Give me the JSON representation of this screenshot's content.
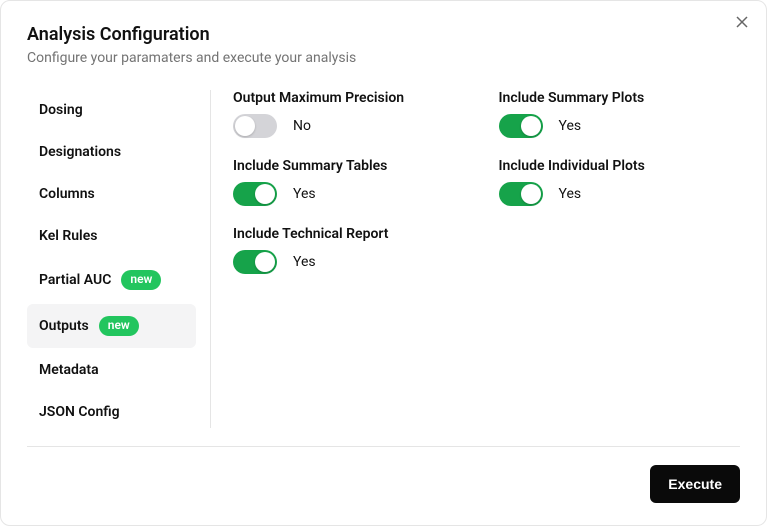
{
  "header": {
    "title": "Analysis Configuration",
    "subtitle": "Configure your paramaters and execute your analysis"
  },
  "sidebar": {
    "items": [
      {
        "label": "Dosing",
        "badge": null,
        "active": false
      },
      {
        "label": "Designations",
        "badge": null,
        "active": false
      },
      {
        "label": "Columns",
        "badge": null,
        "active": false
      },
      {
        "label": "Kel Rules",
        "badge": null,
        "active": false
      },
      {
        "label": "Partial AUC",
        "badge": "new",
        "active": false
      },
      {
        "label": "Outputs",
        "badge": "new",
        "active": true
      },
      {
        "label": "Metadata",
        "badge": null,
        "active": false
      },
      {
        "label": "JSON Config",
        "badge": null,
        "active": false
      }
    ]
  },
  "settings": [
    {
      "label": "Output Maximum Precision",
      "on": false,
      "value": "No"
    },
    {
      "label": "Include Summary Plots",
      "on": true,
      "value": "Yes"
    },
    {
      "label": "Include Summary Tables",
      "on": true,
      "value": "Yes"
    },
    {
      "label": "Include Individual Plots",
      "on": true,
      "value": "Yes"
    },
    {
      "label": "Include Technical Report",
      "on": true,
      "value": "Yes"
    }
  ],
  "footer": {
    "execute_label": "Execute"
  }
}
